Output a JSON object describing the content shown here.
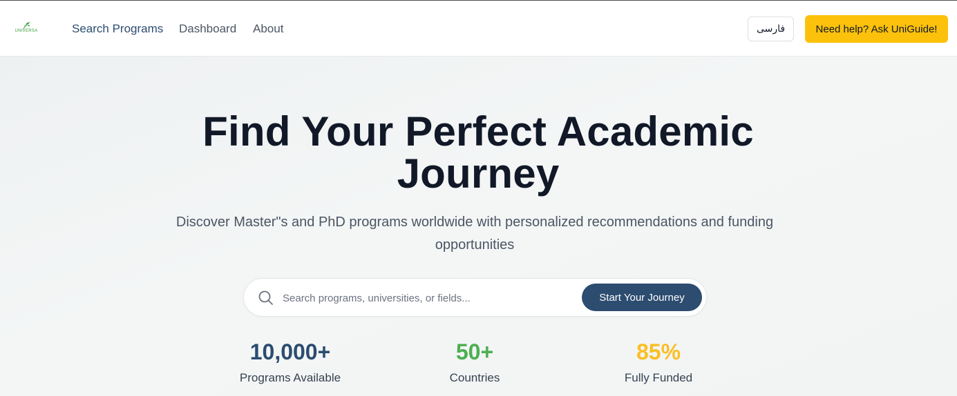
{
  "header": {
    "logo_text": "UNIVERSA",
    "nav": [
      {
        "label": "Search Programs",
        "active": true
      },
      {
        "label": "Dashboard",
        "active": false
      },
      {
        "label": "About",
        "active": false
      }
    ],
    "language_label": "فارسی",
    "help_label": "Need help? Ask UniGuide!"
  },
  "hero": {
    "title": "Find Your Perfect Academic Journey",
    "subtitle": "Discover Master\"s and PhD programs worldwide with personalized recommendations and funding opportunities"
  },
  "search": {
    "placeholder": "Search programs, universities, or fields...",
    "value": "",
    "button_label": "Start Your Journey"
  },
  "stats": [
    {
      "value": "10,000+",
      "label": "Programs Available",
      "color": "#2c4c70"
    },
    {
      "value": "50+",
      "label": "Countries",
      "color": "#4caf50"
    },
    {
      "value": "85%",
      "label": "Fully Funded",
      "color": "#fbbf24"
    }
  ],
  "colors": {
    "primary": "#2c4c70",
    "accent": "#fcc10a",
    "brand_green": "#3a9a3a"
  }
}
